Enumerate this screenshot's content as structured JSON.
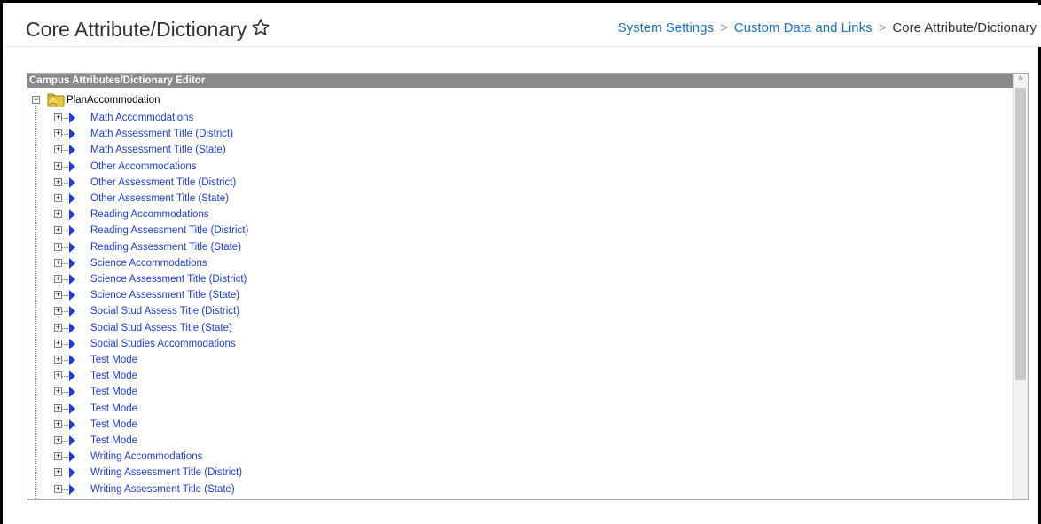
{
  "header": {
    "title": "Core Attribute/Dictionary",
    "star_icon": "star-outline-icon"
  },
  "breadcrumb": {
    "items": [
      "System Settings",
      "Custom Data and Links",
      "Core Attribute/Dictionary"
    ],
    "separator": ">"
  },
  "editor": {
    "title": "Campus Attributes/Dictionary Editor",
    "scroll_up_glyph": "^",
    "root": {
      "label": "PlanAccommodation",
      "toggle": "−",
      "icon": "folder-database-icon"
    },
    "item_toggle": "+",
    "items": [
      "Math Accommodations",
      "Math Assessment Title (District)",
      "Math Assessment Title (State)",
      "Other Accommodations",
      "Other Assessment Title (District)",
      "Other Assessment Title (State)",
      "Reading Accommodations",
      "Reading Assessment Title (District)",
      "Reading Assessment Title (State)",
      "Science Accommodations",
      "Science Assessment Title (District)",
      "Science Assessment Title (State)",
      "Social Stud Assess Title (District)",
      "Social Stud Assess Title (State)",
      "Social Studies Accommodations",
      "Test Mode",
      "Test Mode",
      "Test Mode",
      "Test Mode",
      "Test Mode",
      "Test Mode",
      "Writing Accommodations",
      "Writing Assessment Title (District)",
      "Writing Assessment Title (State)"
    ]
  },
  "colors": {
    "link": "#1a73c5",
    "tree_link": "#1a3cdc",
    "editor_header_bg": "#8a8a8a",
    "arrow": "#1a3cdc",
    "folder": "#e8c93a"
  }
}
